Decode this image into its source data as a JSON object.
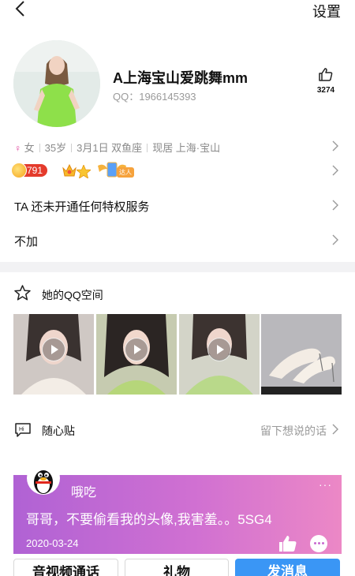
{
  "topbar": {
    "back_icon": "back-chevron-icon",
    "settings_label": "设置"
  },
  "profile": {
    "nickname": "A上海宝山爱跳舞mm",
    "qq_number": "QQ：1966145393",
    "like_count": "3274"
  },
  "info": {
    "gender": "女",
    "age": "35岁",
    "birthday": "3月1日 双鱼座",
    "location": "现居 上海·宝山"
  },
  "badges": {
    "level": "791",
    "daren_label": "达人"
  },
  "privilege": {
    "label": "TA 还未开通任何特权服务"
  },
  "tag": {
    "label": "不加"
  },
  "qzone": {
    "title": "她的QQ空间"
  },
  "suixintie": {
    "title": "随心贴",
    "more_label": "留下想说的话"
  },
  "card": {
    "author": "哦吃",
    "text": "哥哥，不要偷看我的头像,我害羞。。5SG4",
    "date": "2020-03-24",
    "more": "···"
  },
  "buttons": {
    "call": "音视频通话",
    "gift": "礼物",
    "message": "发消息"
  },
  "colors": {
    "accent": "#3a96f5",
    "level_pill": "#e43b2c",
    "card_start": "#b062d4",
    "card_end": "#ec88c6"
  }
}
